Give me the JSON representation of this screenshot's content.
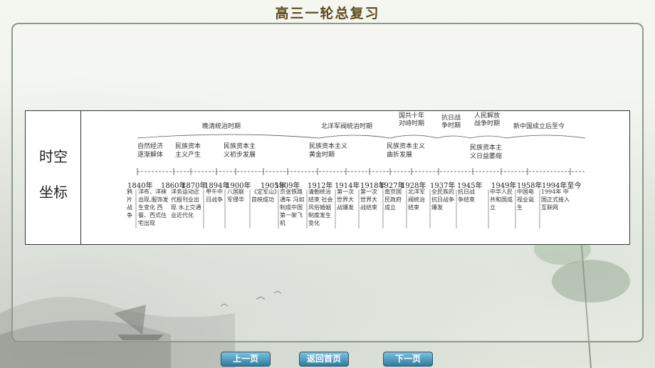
{
  "header": {
    "title": "高三一轮总复习"
  },
  "left_label": {
    "line1": "时空",
    "line2": "坐标"
  },
  "periods": {
    "late_qing": "晚清统治时期",
    "beiyang": "北洋军阀统治时期",
    "kmt_10yr_l1": "国共十年",
    "kmt_10yr_l2": "对峙时期",
    "anti_japan_l1": "抗日战",
    "anti_japan_l2": "争时期",
    "liberation_l1": "人民解放",
    "liberation_l2": "战争时期",
    "new_china": "新中国成立后至今"
  },
  "stages": {
    "s1_l1": "自然经济",
    "s1_l2": "逐渐解体",
    "s2_l1": "民族资本",
    "s2_l2": "主义产生",
    "s3_l1": "民族资本主",
    "s3_l2": "义初步发展",
    "s4_l1": "民族资本主义",
    "s4_l2": "黄金时期",
    "s5_l1": "民族资本主义",
    "s5_l2": "曲折发展",
    "s6_l1": "民族资本主",
    "s6_l2": "义日益萎缩"
  },
  "years": {
    "y1840": "1840年",
    "y1860": "1860年",
    "y1870": "1870年",
    "y1894": "1894年",
    "y1900": "1900年",
    "y1905": "1905年",
    "y1909": "1909年",
    "y1912": "1912年",
    "y1914": "1914年",
    "y1918": "1918年",
    "y1927": "1927年",
    "y1928": "1928年",
    "y1937": "1937年",
    "y1945": "1945年",
    "y1949": "1949年",
    "y1958": "1958年",
    "y1994": "1994年至今"
  },
  "events": {
    "e1840": "鸦片战争",
    "e1860": "洋布、洋袜出现,服饰发生变化 西餐、西式住宅出现",
    "e1870": "洋务运动近代报刊业出现 水上交通业近代化",
    "e1894": "甲午中日战争",
    "e1900": "八国联军侵华",
    "e1905": "《定军山》首映成功",
    "e1909": "京张铁路通车 冯如制成中国第一架飞机",
    "e1912": "清朝统治结束 社会风俗婚姻制度发生变化",
    "e1914": "第一次世界大战爆发",
    "e1918": "第一次世界大战结束",
    "e1927": "南京国民政府成立",
    "e1928": "北洋军阀统治结束",
    "e1937": "全民族的抗日战争爆发",
    "e1945": "抗日战争结束",
    "e1949": "中华人民共和国成立",
    "e1958": "中国电视业诞生",
    "e1994": "1994年 中国正式接入互联网"
  },
  "nav": {
    "prev": "上一页",
    "home": "返回首页",
    "next": "下一页"
  }
}
